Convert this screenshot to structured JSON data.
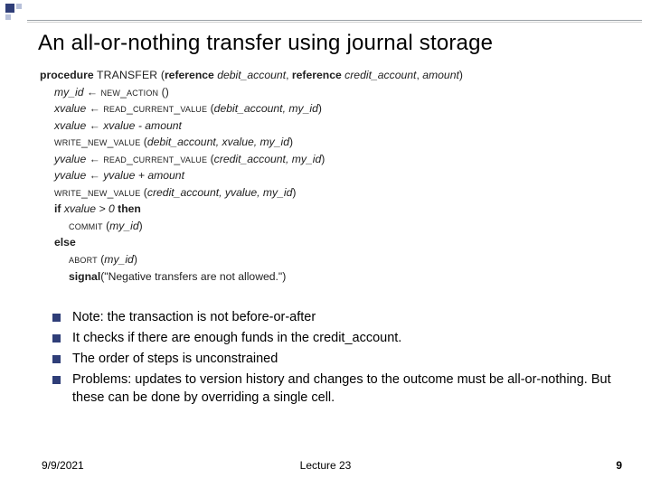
{
  "title": "An all-or-nothing transfer using journal storage",
  "code": {
    "l0a": "procedure ",
    "l0b": "TRANSFER ",
    "l0c": "(",
    "l0d": "reference ",
    "l0e": "debit_account",
    "l0f": ", ",
    "l0g": "reference ",
    "l0h": "credit_account",
    "l0i": ", ",
    "l0j": "amount",
    "l0k": ")",
    "l1a": "my_id",
    "l1b": " ← ",
    "l1c": "new_action",
    "l1d": " ()",
    "l2a": "xvalue",
    "l2b": " ← ",
    "l2c": "read_current_value",
    "l2d": " (",
    "l2e": "debit_account, my_id",
    "l2f": ")",
    "l3a": "xvalue",
    "l3b": " ← ",
    "l3c": "xvalue - amount",
    "l4a": "write_new_value",
    "l4b": " (",
    "l4c": "debit_account, xvalue, my_id",
    "l4d": ")",
    "l5a": "yvalue",
    "l5b": " ← ",
    "l5c": "read_current_value",
    "l5d": " (",
    "l5e": "credit_account, my_id",
    "l5f": ")",
    "l6a": "yvalue",
    "l6b": " ← ",
    "l6c": "yvalue + amount",
    "l7a": "write_new_value",
    "l7b": " (",
    "l7c": "credit_account, yvalue, my_id",
    "l7d": ")",
    "l8a": "if ",
    "l8b": "xvalue > 0",
    "l8c": " then",
    "l9a": "commit",
    "l9b": " (",
    "l9c": "my_id",
    "l9d": ")",
    "l10a": "else",
    "l11a": "abort",
    "l11b": " (",
    "l11c": "my_id",
    "l11d": ")",
    "l12a": "signal",
    "l12b": "(\"Negative transfers are not allowed.\")"
  },
  "notes": [
    "Note: the transaction is not before-or-after",
    "It checks if there are enough funds in the credit_account.",
    "The order of steps is unconstrained",
    "Problems: updates to version history  and changes to the outcome must be all-or-nothing. But these can be done by overriding a single cell."
  ],
  "footer": {
    "date": "9/9/2021",
    "center": "Lecture 23",
    "page": "9"
  }
}
